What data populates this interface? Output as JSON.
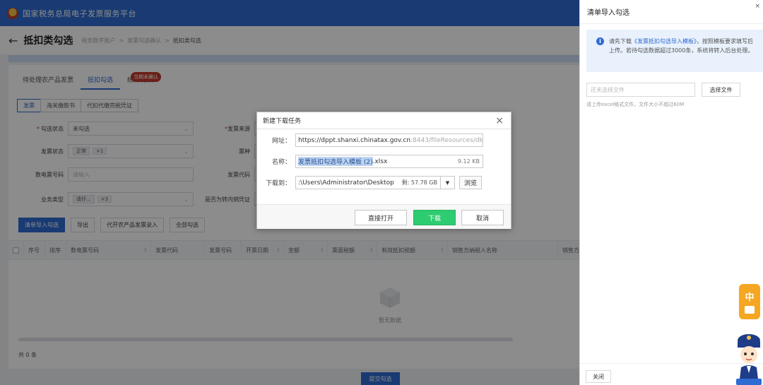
{
  "app": {
    "title": "国家税务总局电子发票服务平台"
  },
  "page": {
    "title": "抵扣类勾选",
    "breadcrumbs": [
      "税务数字账户",
      "发票勾选确认",
      "抵扣类勾选"
    ]
  },
  "tabs": [
    {
      "label": "待处理农产品发票",
      "active": false
    },
    {
      "label": "抵扣勾选",
      "active": true
    },
    {
      "label": "统计确认",
      "active": false
    }
  ],
  "badge": "当期未确认",
  "subtabs": [
    {
      "label": "发票",
      "active": true
    },
    {
      "label": "海关缴款书",
      "active": false
    },
    {
      "label": "代扣代缴完税凭证",
      "active": false
    }
  ],
  "filters": {
    "check_status": {
      "label": "勾选状态",
      "value": "未勾选"
    },
    "invoice_source": {
      "label": "发票来源"
    },
    "invoice_status": {
      "label": "发票状态",
      "value": "正常",
      "extra": "+1"
    },
    "invoice_type": {
      "label": "票种"
    },
    "digital_no": {
      "label": "数电票号码",
      "placeholder": "请输入"
    },
    "invoice_code": {
      "label": "发票代码"
    },
    "business_type": {
      "label": "业务类型",
      "value": "请仔...",
      "extra": "+3"
    },
    "reverse": {
      "label": "是否为转内销凭证"
    },
    "right_label_1": "开",
    "right_label_2": "销售"
  },
  "actions": [
    "清单导入勾选",
    "导出",
    "代开农产品发票录入",
    "全部勾选"
  ],
  "table": {
    "columns": [
      "序号",
      "排序",
      "数电票号码",
      "发票代码",
      "发票号码",
      "开票日期",
      "金额",
      "票面税额",
      "有效抵扣税额",
      "销售方纳税人名称",
      "销售方"
    ]
  },
  "empty_text": "暂无数据",
  "total": "共 0 条",
  "submit": "提交勾选",
  "dialog": {
    "title": "新建下载任务",
    "url_label": "网址：",
    "url_host": "https://dppt.shanxi.chinatax.gov.cn",
    "url_rest": ":8443/fileResources/dkg",
    "url_prefix": "https://",
    "name_label": "名称：",
    "name_selected": "发票抵扣勾选导入模板 (2)",
    "name_ext": ".xlsx",
    "size": "9.12 KB",
    "save_label": "下载到：",
    "save_path": ":\\Users\\Administrator\\Desktop",
    "free": "剩: 57.78 GB",
    "browse": "浏览",
    "open_btn": "直接打开",
    "download_btn": "下载",
    "cancel_btn": "取消"
  },
  "drawer": {
    "title": "清单导入勾选",
    "info_before": "请先下载",
    "info_link": "《发票抵扣勾选导入模板》",
    "info_after": "，按照模板要求填写后上传。若待勾选数据超过3000条，系统将转入后台处理。",
    "file_placeholder": "还未选择文件",
    "file_button": "选择文件",
    "hint": "请上传excel格式文件，文件大小不超过60M",
    "close": "关闭"
  },
  "ime": {
    "label": "中"
  },
  "colors": {
    "primary": "#2f6bd0",
    "download": "#2ecc71",
    "badge": "#c0392b"
  }
}
